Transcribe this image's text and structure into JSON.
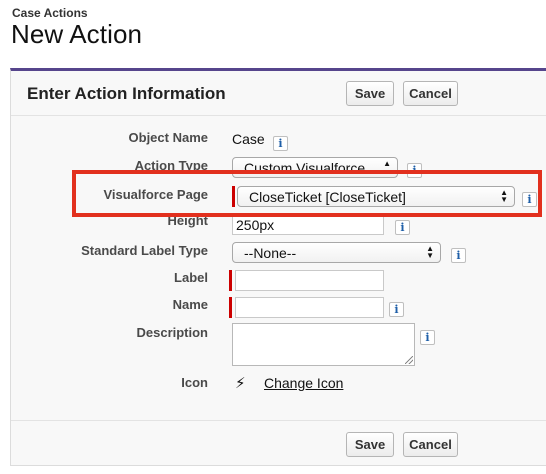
{
  "header": {
    "breadcrumb": "Case Actions",
    "title": "New Action"
  },
  "section": {
    "title": "Enter Action Information"
  },
  "toolbar": {
    "save_label": "Save",
    "cancel_label": "Cancel"
  },
  "fields": {
    "object_name": {
      "label": "Object Name",
      "value": "Case"
    },
    "action_type": {
      "label": "Action Type",
      "value": "Custom Visualforce"
    },
    "visualforce_page": {
      "label": "Visualforce Page",
      "value": "CloseTicket [CloseTicket]"
    },
    "height": {
      "label": "Height",
      "value": "250px"
    },
    "standard_label_type": {
      "label": "Standard Label Type",
      "value": "--None--"
    },
    "label": {
      "label": "Label",
      "value": ""
    },
    "name": {
      "label": "Name",
      "value": ""
    },
    "description": {
      "label": "Description",
      "value": ""
    },
    "icon": {
      "label": "Icon",
      "link": "Change Icon",
      "glyph": "⚡"
    }
  },
  "info_glyph": "i",
  "select_arrows": {
    "up": "▲",
    "down": "▼"
  },
  "colors": {
    "accent": "#56458c",
    "required": "#cc0000",
    "highlight": "#e2301e"
  }
}
